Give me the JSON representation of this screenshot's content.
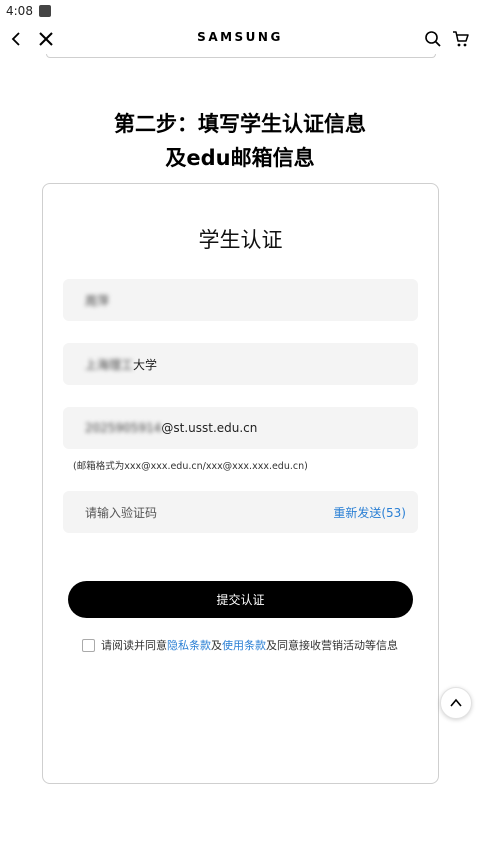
{
  "status": {
    "time": "4:08"
  },
  "header": {
    "brand": "SAMSUNG"
  },
  "step": {
    "line1": "第二步：填写学生认证信息",
    "line2": "及edu邮箱信息"
  },
  "form": {
    "title": "学生认证",
    "name_value": "周萍",
    "school_blurred": "上海理工",
    "school_suffix": "大学",
    "email_blurred": "2025905914",
    "email_suffix": "@st.usst.edu.cn",
    "email_hint": "(邮箱格式为xxx@xxx.edu.cn/xxx@xxx.xxx.edu.cn)",
    "code_placeholder": "请输入验证码",
    "resend_label": "重新发送(53)",
    "submit_label": "提交认证",
    "agree_prefix": "请阅读并同意",
    "privacy_link": "隐私条款",
    "agree_and": " 及",
    "terms_link": "使用条款",
    "agree_suffix": " 及同意接收营销活动等信息"
  },
  "colors": {
    "link": "#2a7fd4",
    "button_bg": "#000000",
    "field_bg": "#f4f4f4"
  },
  "icons": [
    "back-icon",
    "close-icon",
    "search-icon",
    "cart-icon",
    "chevron-up-icon"
  ]
}
